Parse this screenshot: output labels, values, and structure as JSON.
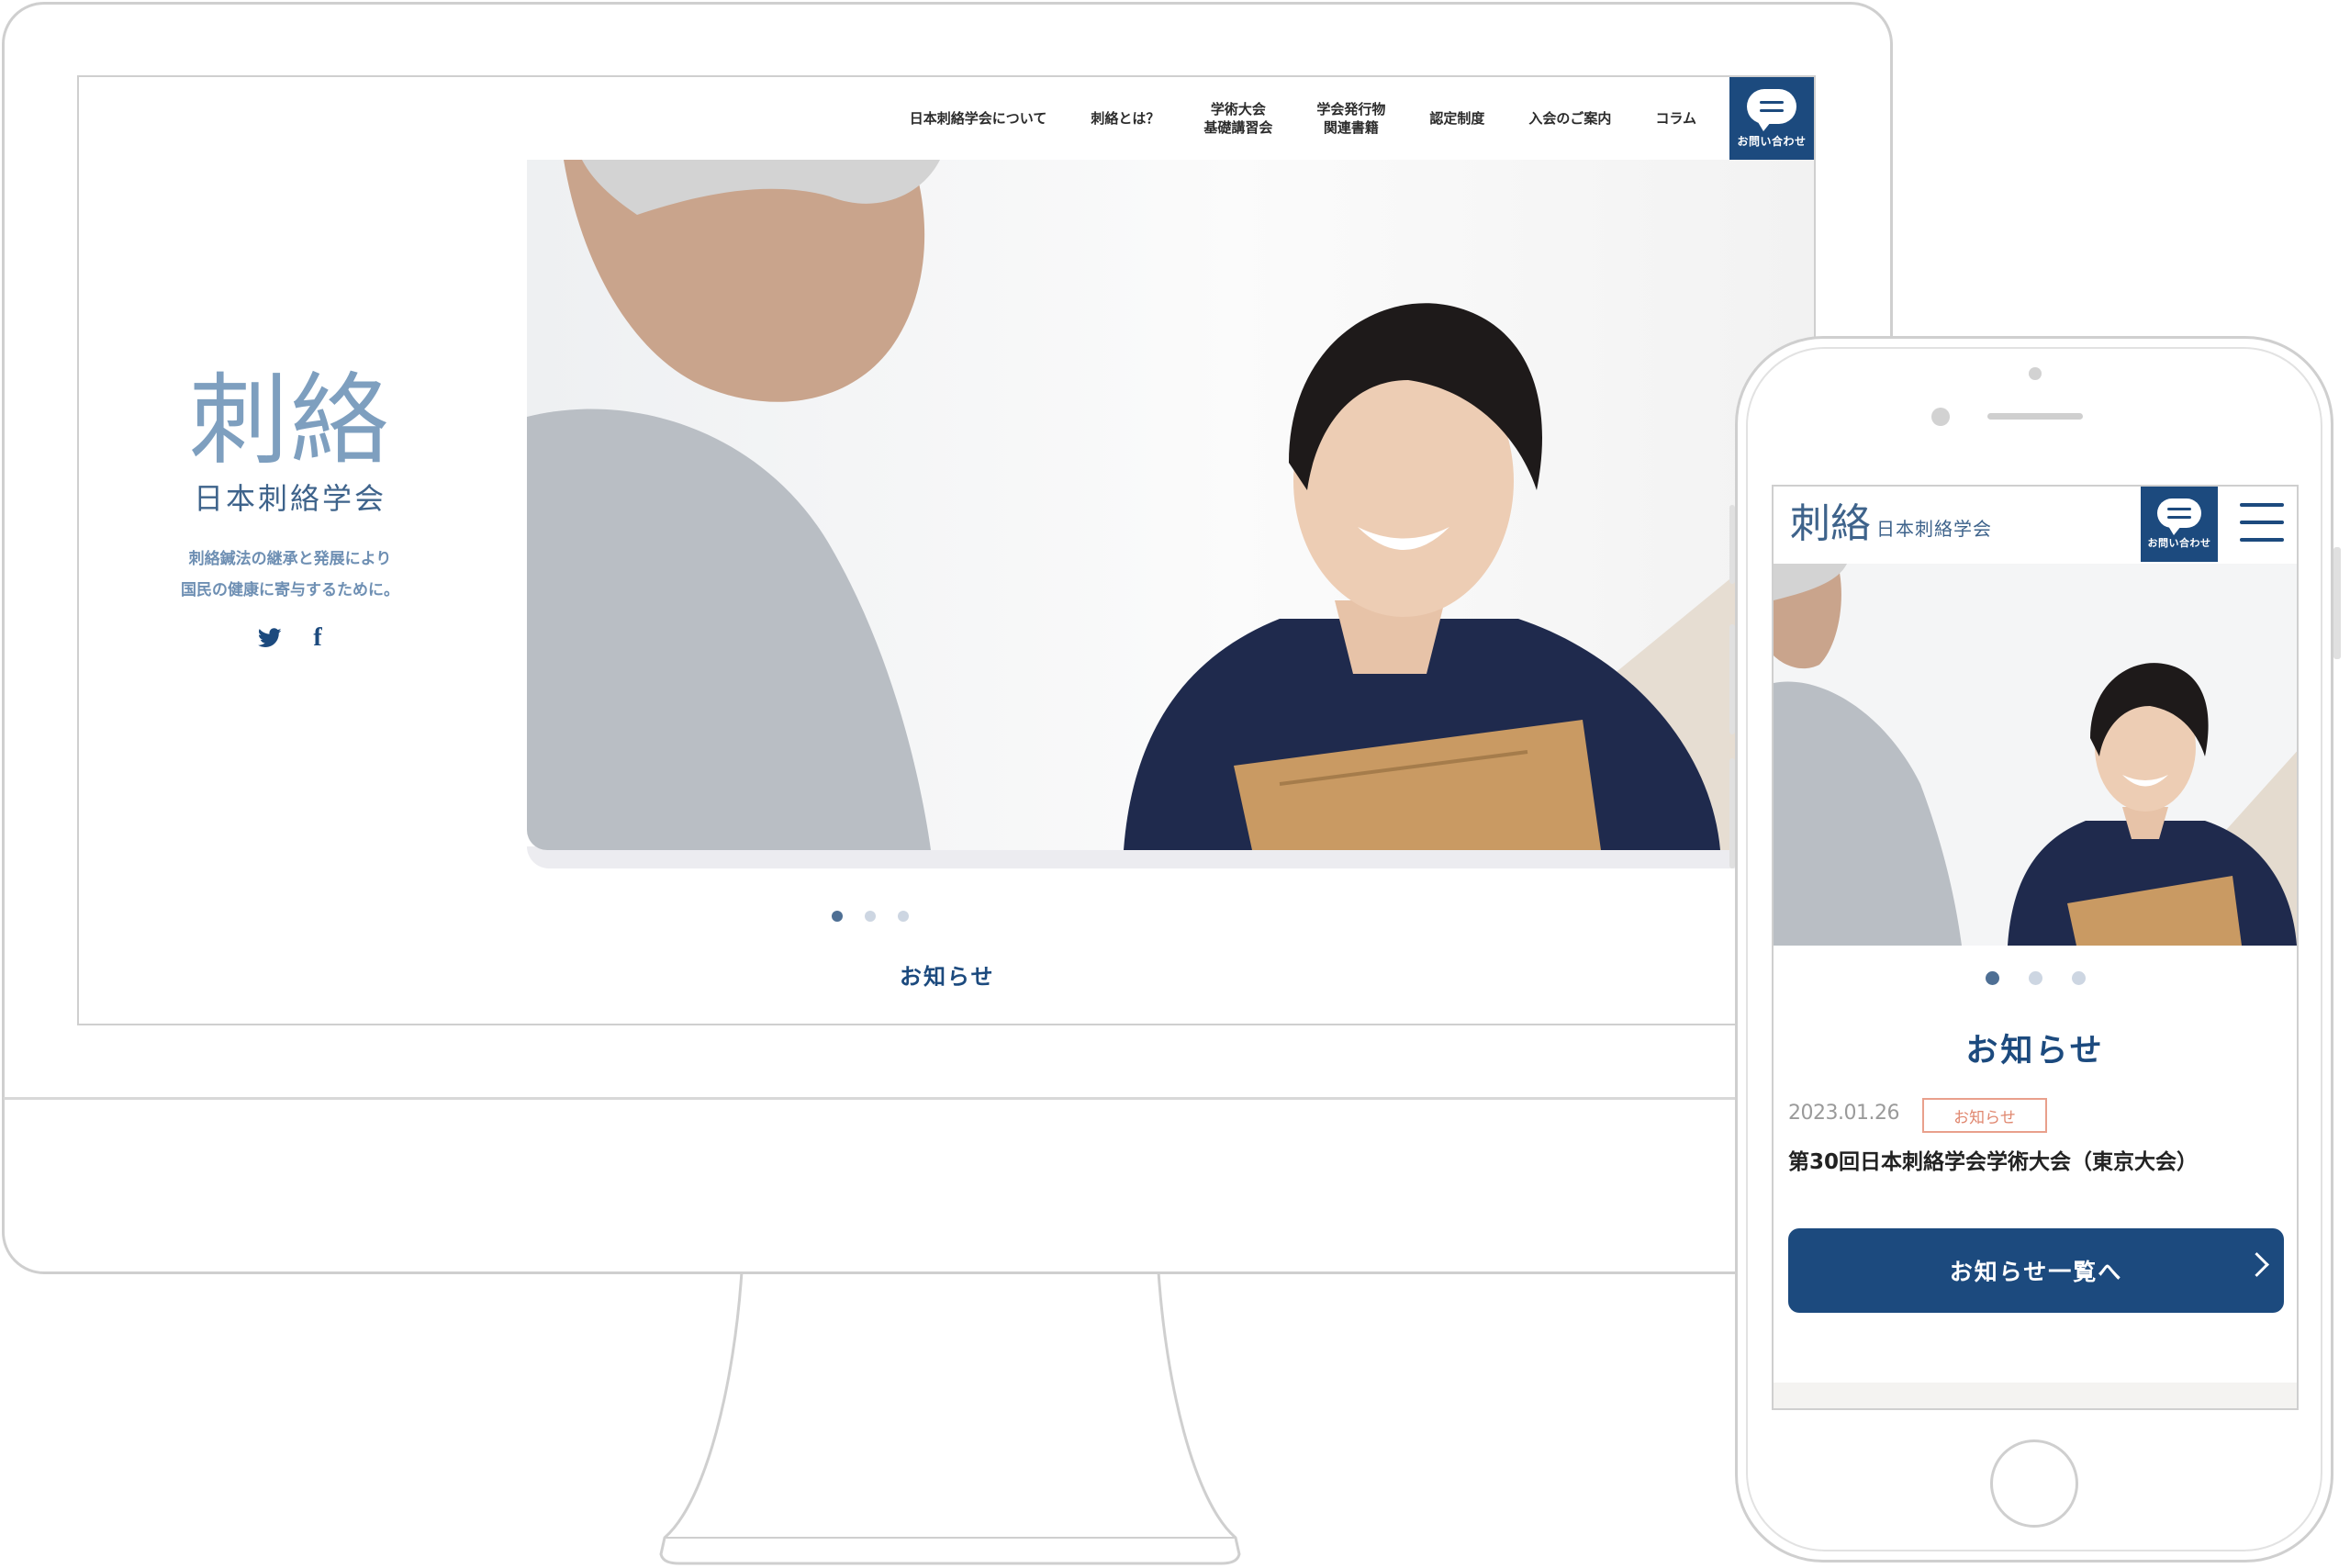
{
  "desktop": {
    "nav": {
      "items": [
        {
          "label": "日本刺絡学会について"
        },
        {
          "label": "刺絡とは？"
        },
        {
          "label": "学術大会\n基礎講習会"
        },
        {
          "label": "学会発行物\n関連書籍"
        },
        {
          "label": "認定制度"
        },
        {
          "label": "入会のご案内"
        },
        {
          "label": "コラム"
        }
      ],
      "contact_label": "お問い合わせ",
      "contact_icon": "chat-bubble-icon"
    },
    "brand": {
      "logo_glyphs": "刺絡",
      "name": "日本刺絡学会",
      "tagline_line1": "刺絡鍼法の継承と発展により",
      "tagline_line2": "国民の健康に寄与するために。"
    },
    "social": {
      "twitter_glyph": "🐦",
      "facebook_glyph": "f"
    },
    "slider_dots": 3,
    "active_dot": 1,
    "news_heading": "お知らせ"
  },
  "phone": {
    "header": {
      "logo_glyphs": "刺絡",
      "name": "日本刺絡学会",
      "contact_label": "お問い合わせ",
      "menu_icon": "hamburger-icon"
    },
    "slider_dots": 3,
    "active_dot": 1,
    "news_heading": "お知らせ",
    "news": [
      {
        "date": "2023.01.26",
        "tag": "お知らせ",
        "title": "第30回日本刺絡学会学術大会（東京大会）"
      }
    ],
    "more_button_label": "お知らせ一覧へ"
  },
  "colors": {
    "primary_navy": "#1c4a7e",
    "logo_blue": "#7e9fbf",
    "tag_orange": "#e0876f",
    "frame_gray": "#cfcfcf"
  }
}
